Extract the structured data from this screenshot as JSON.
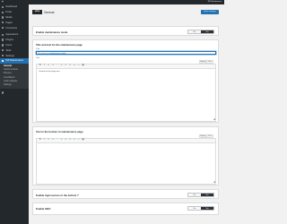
{
  "admin_bar": {
    "site_label": "WP Maintenance",
    "user_label": "Howdy, admin"
  },
  "sidebar": {
    "items_top": [
      {
        "label": "Dashboard",
        "icon": "dashboard-icon"
      },
      {
        "label": "Posts",
        "icon": "pin-icon"
      },
      {
        "label": "Media",
        "icon": "media-icon"
      },
      {
        "label": "Pages",
        "icon": "page-icon"
      },
      {
        "label": "Comments",
        "icon": "comment-icon"
      }
    ],
    "items_mid": [
      {
        "label": "Appearance",
        "icon": "brush-icon"
      },
      {
        "label": "Plugins",
        "icon": "plugin-icon"
      },
      {
        "label": "Users",
        "icon": "user-icon"
      },
      {
        "label": "Tools",
        "icon": "wrench-icon"
      },
      {
        "label": "Settings",
        "icon": "settings-icon"
      }
    ],
    "current": {
      "label": "WP Maintenance",
      "icon": "gear-icon"
    },
    "submenu": [
      "General",
      "Colors & Fonts",
      "Pictures",
      "CountDown",
      "Code snippets",
      "Settings"
    ]
  },
  "header": {
    "logo_text": "WPM",
    "title": "General",
    "save_label": "Save changes"
  },
  "toggle": {
    "no": "No",
    "yes": "Yes"
  },
  "sections": {
    "enable": {
      "title": "Enable maintenance mode"
    },
    "title_text": {
      "title": "Title and text for the maintenance page",
      "title_label": "Title",
      "title_value": "The site is in maintenance mode",
      "text_label": "Text",
      "tab_visual": "Visual",
      "tab_text": "Text",
      "body": "Content of the page text"
    },
    "bottom": {
      "title": "Text in the bottom of maintenance page",
      "tab_visual": "Visual",
      "tab_text": "Text"
    },
    "login": {
      "title": "Enable login access in the bottom ?"
    },
    "seo": {
      "title": "Enable SEO:"
    }
  },
  "colors": {
    "accent": "#2271b1",
    "sidebar_bg": "#23282d",
    "page_bg": "#f1f1f1"
  }
}
